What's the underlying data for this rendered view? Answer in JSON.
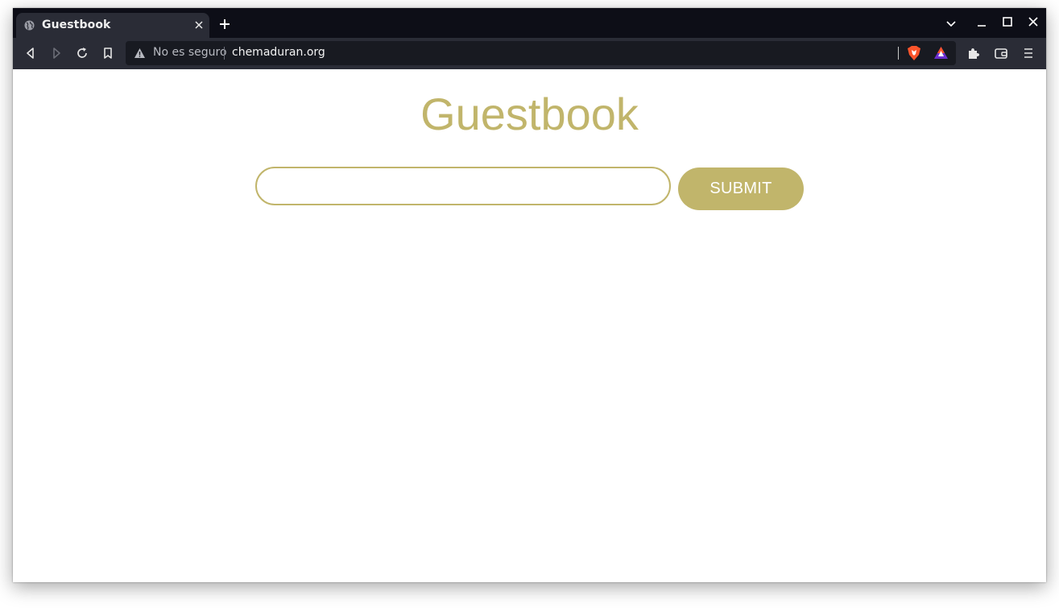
{
  "browser": {
    "tab": {
      "title": "Guestbook",
      "favicon": "globe-icon",
      "close_icon": "close-icon"
    },
    "new_tab_icon": "plus-icon",
    "window_controls": [
      "chevron-down-icon",
      "minimize-icon",
      "maximize-icon",
      "close-icon"
    ],
    "toolbar": {
      "back_icon": "back-icon",
      "forward_icon": "forward-icon",
      "reload_icon": "reload-icon",
      "bookmark_icon": "bookmark-icon",
      "security_icon": "warning-icon",
      "security_text": "No es seguro",
      "url": "chemaduran.org",
      "shields_icon": "brave-shields-icon",
      "rewards_icon": "brave-rewards-icon",
      "extensions_icon": "puzzle-icon",
      "wallet_icon": "wallet-icon",
      "menu_icon": "hamburger-menu-icon"
    }
  },
  "page": {
    "title": "Guestbook",
    "input": {
      "value": "",
      "placeholder": ""
    },
    "submit_label": "SUBMIT"
  },
  "colors": {
    "accent": "#c1b56b",
    "tabstrip": "#0d0e17",
    "toolbar": "#2a2c36",
    "urlbar": "#181a21"
  }
}
